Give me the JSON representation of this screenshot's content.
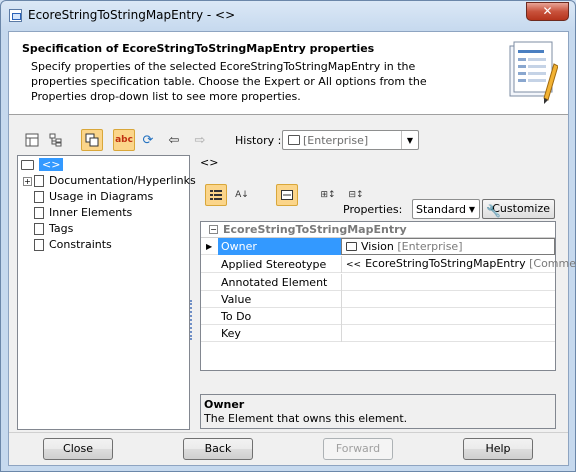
{
  "window": {
    "title": "EcoreStringToStringMapEntry - <>",
    "close_glyph": "✕"
  },
  "header": {
    "title": "Specification of EcoreStringToStringMapEntry properties",
    "description": "Specify properties of the selected EcoreStringToStringMapEntry in the properties specification table. Choose the Expert or All options from the Properties drop-down list to see more properties."
  },
  "toolbar": {
    "history_label": "History :",
    "history_value": "[Enterprise]"
  },
  "tree": {
    "root_label": "<>",
    "items": [
      {
        "label": "Documentation/Hyperlinks",
        "expandable": true
      },
      {
        "label": "Usage in Diagrams",
        "expandable": false
      },
      {
        "label": "Inner Elements",
        "expandable": false
      },
      {
        "label": "Tags",
        "expandable": false
      },
      {
        "label": "Constraints",
        "expandable": false
      }
    ]
  },
  "panel": {
    "title": "<>",
    "properties_label": "Properties:",
    "properties_value": "Standard",
    "customize_label": "Customize"
  },
  "grid": {
    "group_label": "EcoreStringToStringMapEntry",
    "rows": [
      {
        "name": "Owner",
        "value": "Vision",
        "value_suffix": "[Enterprise]",
        "selected": true
      },
      {
        "name": "Applied Stereotype",
        "value": "EcoreStringToStringMapEntry",
        "value_suffix": "[Comment]",
        "value_prefix": "<<"
      },
      {
        "name": "Annotated Element",
        "value": ""
      },
      {
        "name": "Value",
        "value": ""
      },
      {
        "name": "To Do",
        "value": ""
      },
      {
        "name": "Key",
        "value": ""
      }
    ]
  },
  "description": {
    "title": "Owner",
    "text": "The Element that owns this element."
  },
  "buttons": {
    "close": "Close",
    "back": "Back",
    "forward": "Forward",
    "help": "Help"
  }
}
